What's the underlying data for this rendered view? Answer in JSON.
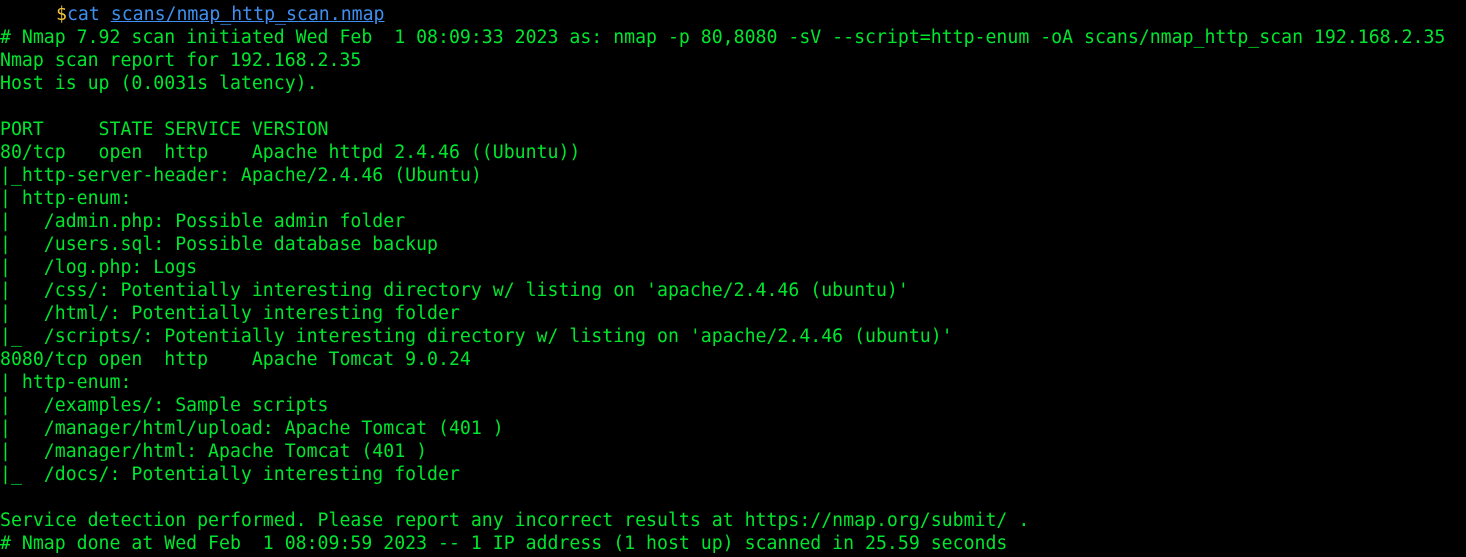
{
  "terminal": {
    "colors": {
      "background": "#000000",
      "output": "#00e62e",
      "prompt_symbol": "#f0c63a",
      "command": "#3f8ff0"
    },
    "prompt": {
      "symbol": "$",
      "command": "cat",
      "argument": "scans/nmap_http_scan.nmap"
    },
    "lines": [
      "# Nmap 7.92 scan initiated Wed Feb  1 08:09:33 2023 as: nmap -p 80,8080 -sV --script=http-enum -oA scans/nmap_http_scan 192.168.2.35",
      "Nmap scan report for 192.168.2.35",
      "Host is up (0.0031s latency).",
      "",
      "PORT     STATE SERVICE VERSION",
      "80/tcp   open  http    Apache httpd 2.4.46 ((Ubuntu))",
      "|_http-server-header: Apache/2.4.46 (Ubuntu)",
      "| http-enum:",
      "|   /admin.php: Possible admin folder",
      "|   /users.sql: Possible database backup",
      "|   /log.php: Logs",
      "|   /css/: Potentially interesting directory w/ listing on 'apache/2.4.46 (ubuntu)'",
      "|   /html/: Potentially interesting folder",
      "|_  /scripts/: Potentially interesting directory w/ listing on 'apache/2.4.46 (ubuntu)'",
      "8080/tcp open  http    Apache Tomcat 9.0.24",
      "| http-enum:",
      "|   /examples/: Sample scripts",
      "|   /manager/html/upload: Apache Tomcat (401 )",
      "|   /manager/html: Apache Tomcat (401 )",
      "|_  /docs/: Potentially interesting folder",
      "",
      "Service detection performed. Please report any incorrect results at https://nmap.org/submit/ .",
      "# Nmap done at Wed Feb  1 08:09:59 2023 -- 1 IP address (1 host up) scanned in 25.59 seconds"
    ]
  }
}
